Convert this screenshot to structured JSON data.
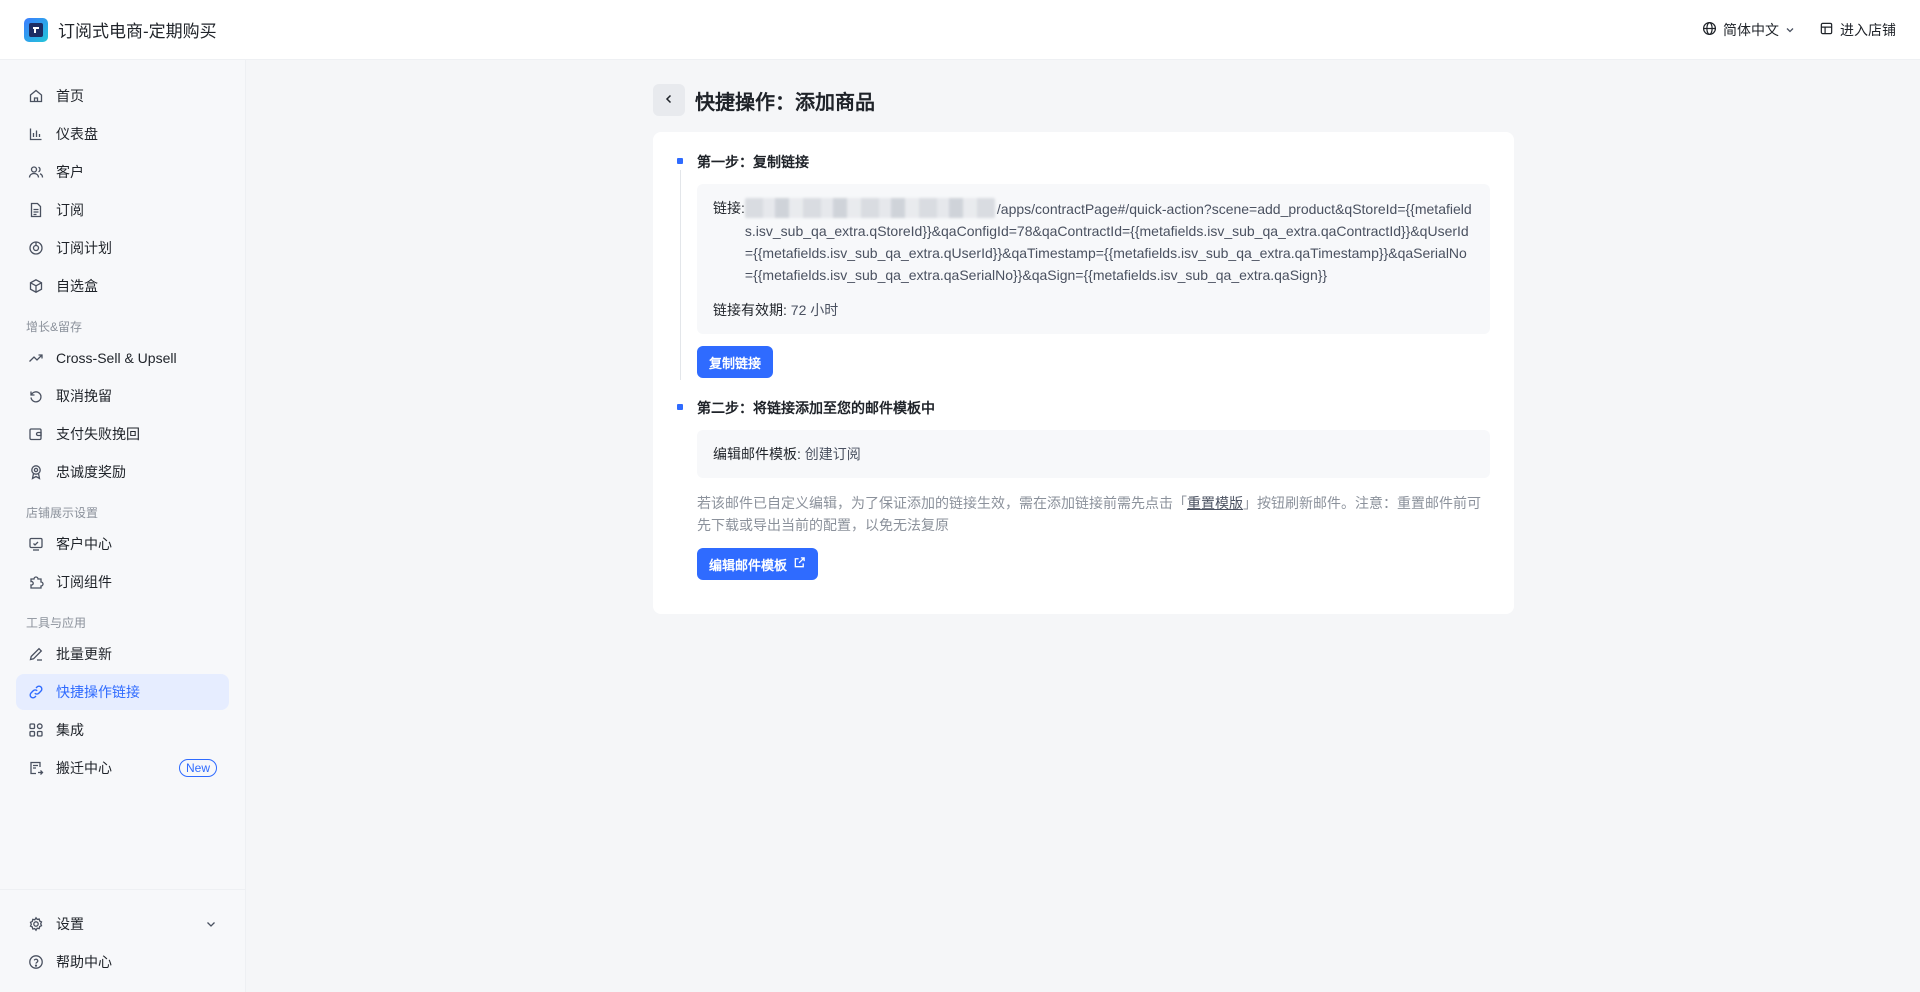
{
  "app": {
    "title": "订阅式电商-定期购买"
  },
  "header": {
    "language": "简体中文",
    "enter_store": "进入店铺"
  },
  "sidebar": {
    "items": [
      {
        "label": "首页"
      },
      {
        "label": "仪表盘"
      },
      {
        "label": "客户"
      },
      {
        "label": "订阅"
      },
      {
        "label": "订阅计划"
      },
      {
        "label": "自选盒"
      }
    ],
    "sections": [
      {
        "title": "增长&留存",
        "items": [
          {
            "label": "Cross-Sell & Upsell"
          },
          {
            "label": "取消挽留"
          },
          {
            "label": "支付失败挽回"
          },
          {
            "label": "忠诚度奖励"
          }
        ]
      },
      {
        "title": "店铺展示设置",
        "items": [
          {
            "label": "客户中心"
          },
          {
            "label": "订阅组件"
          }
        ]
      },
      {
        "title": "工具与应用",
        "items": [
          {
            "label": "批量更新"
          },
          {
            "label": "快捷操作链接"
          },
          {
            "label": "集成"
          },
          {
            "label": "搬迁中心",
            "badge": "New"
          }
        ]
      }
    ],
    "bottom": [
      {
        "label": "设置"
      },
      {
        "label": "帮助中心"
      }
    ],
    "active": "快捷操作链接"
  },
  "page": {
    "title": "快捷操作：添加商品",
    "step1": {
      "title": "第一步：复制链接",
      "link_label": "链接:",
      "link_value": "/apps/contractPage#/quick-action?scene=add_product&qStoreId={{metafields.isv_sub_qa_extra.qStoreId}}&qaConfigId=78&qaContractId={{metafields.isv_sub_qa_extra.qaContractId}}&qUserId={{metafields.isv_sub_qa_extra.qUserId}}&qaTimestamp={{metafields.isv_sub_qa_extra.qaTimestamp}}&qaSerialNo={{metafields.isv_sub_qa_extra.qaSerialNo}}&qaSign={{metafields.isv_sub_qa_extra.qaSign}}",
      "validity_label": "链接有效期:",
      "validity_value": "72 小时",
      "copy_button": "复制链接"
    },
    "step2": {
      "title": "第二步：将链接添加至您的邮件模板中",
      "template_label": "编辑邮件模板:",
      "template_value": "创建订阅",
      "note_before": "若该邮件已自定义编辑，为了保证添加的链接生效，需在添加链接前需先点击「",
      "note_link": "重置模版",
      "note_after": "」按钮刷新邮件。注意：重置邮件前可先下载或导出当前的配置，以免无法复原",
      "edit_button": "编辑邮件模板"
    }
  },
  "colors": {
    "accent": "#2f6bff",
    "active_bg": "#e6edff",
    "background": "#f5f6f8"
  }
}
